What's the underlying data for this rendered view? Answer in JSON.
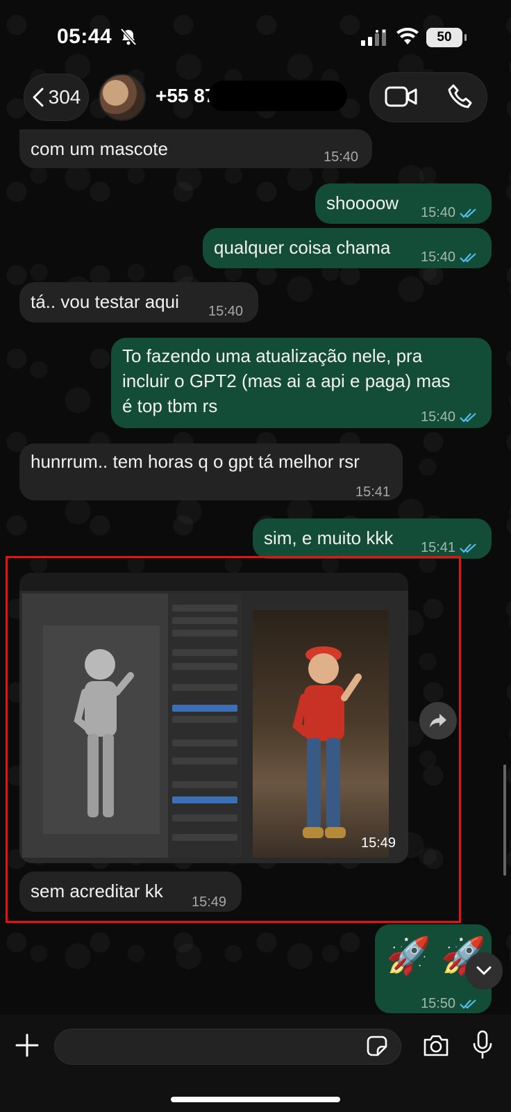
{
  "status_bar": {
    "time": "05:44",
    "battery": "50",
    "icons": [
      "bell-off-icon",
      "signal-icon",
      "wifi-icon",
      "battery-icon"
    ]
  },
  "header": {
    "back_count": "304",
    "contact_name": "+55 87",
    "icons": [
      "chevron-left-icon",
      "video-call-icon",
      "phone-call-icon"
    ]
  },
  "messages": [
    {
      "dir": "in",
      "text": "com um mascote",
      "time": "15:40"
    },
    {
      "dir": "out",
      "text": "shoooow",
      "time": "15:40"
    },
    {
      "dir": "out",
      "text": "qualquer coisa chama",
      "time": "15:40"
    },
    {
      "dir": "in",
      "text": "tá.. vou testar aqui",
      "time": "15:40"
    },
    {
      "dir": "out",
      "text": "To fazendo uma atualização nele, pra\nincluir o GPT2 (mas ai a api e paga) mas\né top tbm rs",
      "time": "15:40"
    },
    {
      "dir": "in",
      "text": "hunrrum.. tem horas q o gpt tá melhor rsr",
      "time": "15:41"
    },
    {
      "dir": "out",
      "text": "sim, e muito kkk",
      "time": "15:41"
    },
    {
      "dir": "in",
      "type": "image",
      "time": "15:49"
    },
    {
      "dir": "in",
      "text": "sem acreditar kk",
      "time": "15:49"
    },
    {
      "dir": "out",
      "text": "🚀 🚀",
      "time": "15:50"
    }
  ],
  "colors": {
    "incoming_bubble": "#232323",
    "outgoing_bubble": "#134d37",
    "read_ticks": "#53bdeb",
    "highlight_border": "#e01616"
  },
  "composer": {
    "icons": [
      "plus-icon",
      "sticker-icon",
      "camera-icon",
      "microphone-icon"
    ]
  }
}
